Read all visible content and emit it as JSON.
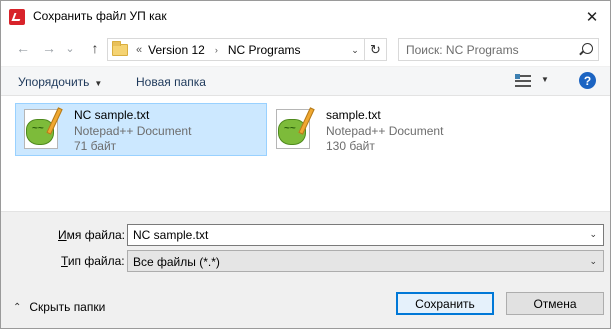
{
  "window": {
    "title": "Сохранить файл УП как",
    "close_glyph": "✕"
  },
  "nav": {
    "back_glyph": "←",
    "forward_glyph": "→",
    "recent_glyph": "⌄",
    "up_glyph": "↑",
    "breadcrumb_sep": "«",
    "breadcrumbs": [
      "Version 12",
      "NC Programs"
    ],
    "breadcrumb_arrow": "›",
    "dropdown_glyph": "⌄",
    "refresh_glyph": "↻",
    "search_placeholder": "Поиск: NC Programs"
  },
  "commands": {
    "organize_label": "Упорядочить",
    "organize_caret": "▼",
    "new_folder_label": "Новая папка",
    "view_caret": "▼",
    "help_glyph": "?"
  },
  "files": [
    {
      "name": "NC sample.txt",
      "type": "Notepad++ Document",
      "size": "71 байт",
      "selected": true
    },
    {
      "name": "sample.txt",
      "type": "Notepad++ Document",
      "size": "130 байт",
      "selected": false
    }
  ],
  "form": {
    "filename_label_accel": "И",
    "filename_label_rest": "мя файла:",
    "filename_value": "NC sample.txt",
    "filename_caret": "⌄",
    "filetype_label_accel": "Т",
    "filetype_label_rest": "ип файла:",
    "filetype_value": "Все файлы (*.*)",
    "filetype_caret": "⌄"
  },
  "footer": {
    "hide_folders_glyph": "⌃",
    "hide_folders_label": "Скрыть папки",
    "save_label": "Сохранить",
    "cancel_label": "Отмена"
  },
  "colors": {
    "selection_bg": "#cce8ff",
    "accent": "#0078d7",
    "app_icon": "#d8232a",
    "help_icon": "#1c64c2"
  }
}
